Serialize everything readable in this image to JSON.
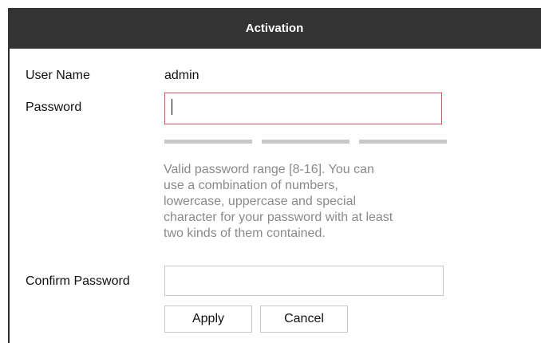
{
  "dialog": {
    "title": "Activation"
  },
  "form": {
    "username_label": "User Name",
    "username_value": "admin",
    "password_label": "Password",
    "password_value": "",
    "password_hint_lines": [
      "Valid password range [8-16]. You can",
      "use a combination of numbers,",
      "lowercase, uppercase and special",
      "character for your password with at least",
      "two kinds of them contained."
    ],
    "password_strength_segments": 3,
    "password_strength_level": 0,
    "confirm_label": "Confirm Password",
    "confirm_value": ""
  },
  "buttons": {
    "apply_label": "Apply",
    "cancel_label": "Cancel"
  },
  "colors": {
    "titlebar": "#333333",
    "focus_border": "#e0505a",
    "strength_empty": "#c8c8c8",
    "hint_text": "#8a8a8a"
  }
}
